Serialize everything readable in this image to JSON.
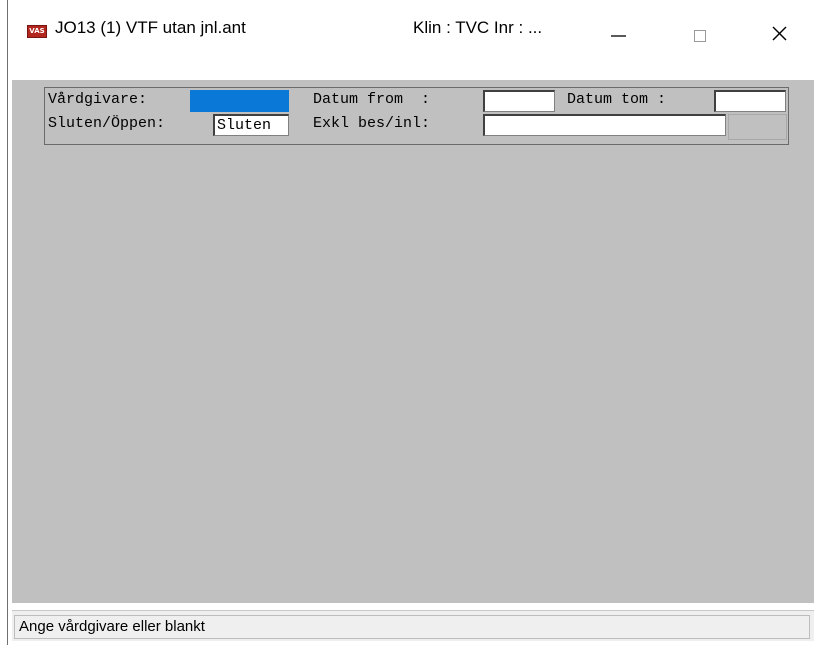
{
  "window": {
    "app_icon_text": "VAS",
    "title": "JO13 (1) VTF utan jnl.ant",
    "title_right": "Klin : TVC  Inr : ...",
    "minimize_glyph": "—",
    "maximize_glyph": "☐",
    "close_glyph": "✕"
  },
  "form": {
    "vardgivare_label": "Vårdgivare:",
    "vardgivare_value": "",
    "datum_from_label": "Datum from  :",
    "datum_from_value": "",
    "datum_tom_label": "Datum tom :",
    "datum_tom_value": "",
    "sluten_label": "Sluten/Öppen:",
    "sluten_value": "Sluten",
    "exkl_label": "Exkl bes/inl:",
    "exkl_value": ""
  },
  "status": {
    "message": "Ange vårdgivare eller blankt"
  },
  "colors": {
    "client_bg": "#c0c0c0",
    "selected_field": "#0a78d7",
    "app_icon": "#b3261e"
  }
}
